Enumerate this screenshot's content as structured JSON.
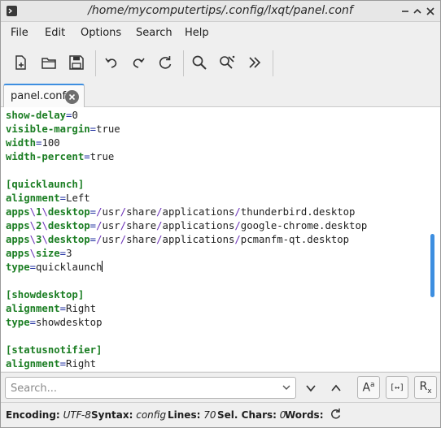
{
  "window": {
    "title": "/home/mycomputertips/.config/lxqt/panel.conf"
  },
  "menu": [
    "File",
    "Edit",
    "Options",
    "Search",
    "Help"
  ],
  "toolbar": {
    "icons": [
      "new-file-icon",
      "open-folder-icon",
      "save-icon",
      "undo-icon",
      "redo-icon",
      "reload-icon",
      "find-icon",
      "replace-icon",
      "go-to-line-icon"
    ]
  },
  "tab": {
    "label": "panel.conf"
  },
  "editor": {
    "lines": [
      {
        "key": "show-delay",
        "value": "0"
      },
      {
        "key": "visible-margin",
        "value": "true"
      },
      {
        "key": "width",
        "value": "100"
      },
      {
        "key": "width-percent",
        "value": "true"
      },
      {
        "blank": true
      },
      {
        "section": "[quicklaunch]"
      },
      {
        "key": "alignment",
        "value": "Left"
      },
      {
        "keyParts": [
          "apps",
          "1",
          "desktop"
        ],
        "valueParts": [
          "",
          "usr",
          "share",
          "applications",
          "thunderbird.desktop"
        ]
      },
      {
        "keyParts": [
          "apps",
          "2",
          "desktop"
        ],
        "valueParts": [
          "",
          "usr",
          "share",
          "applications",
          "google-chrome.desktop"
        ]
      },
      {
        "keyParts": [
          "apps",
          "3",
          "desktop"
        ],
        "valueParts": [
          "",
          "usr",
          "share",
          "applications",
          "pcmanfm-qt.desktop"
        ]
      },
      {
        "keyParts": [
          "apps",
          "size"
        ],
        "value": "3"
      },
      {
        "key": "type",
        "value": "quicklaunch",
        "caret": true
      },
      {
        "blank": true
      },
      {
        "section": "[showdesktop]"
      },
      {
        "key": "alignment",
        "value": "Right"
      },
      {
        "key": "type",
        "value": "showdesktop"
      },
      {
        "blank": true
      },
      {
        "section": "[statusnotifier]"
      },
      {
        "key": "alignment",
        "value": "Right"
      }
    ]
  },
  "find": {
    "placeholder": "Search...",
    "case_label": "A",
    "case_sup": "a",
    "whole_label": "[↔]",
    "regex_label": "R",
    "regex_sub": "x"
  },
  "status": {
    "encoding_label": "Encoding:",
    "encoding_value": "UTF-8",
    "syntax_label": "Syntax:",
    "syntax_value": "config",
    "lines_label": "Lines:",
    "lines_value": "70",
    "selchars_label": "Sel. Chars:",
    "selchars_value": "0",
    "words_label": "Words:"
  },
  "colors": {
    "accent": "#3d8ee0",
    "key": "#1a7d22",
    "operator": "#1f2fa0",
    "path_sep": "#6a2fb8"
  }
}
